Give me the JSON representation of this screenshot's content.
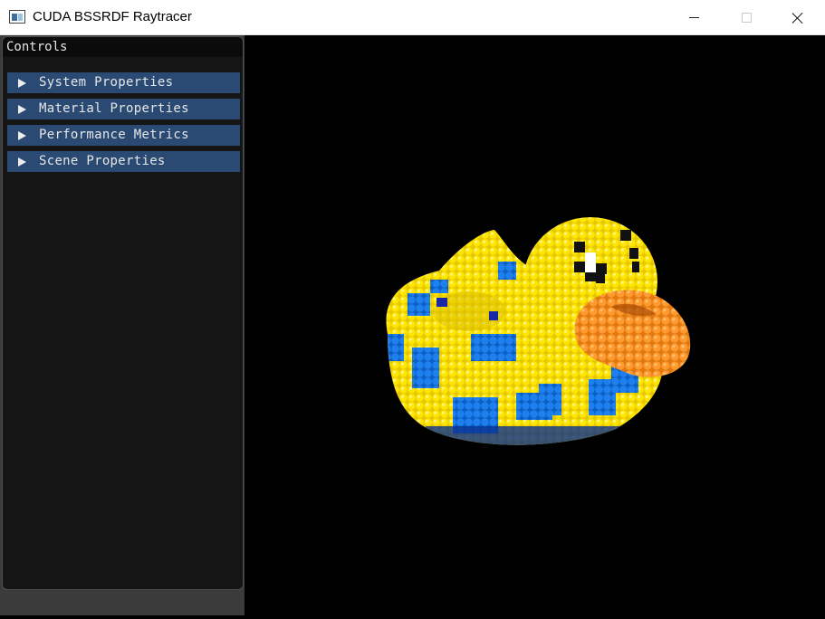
{
  "window": {
    "title": "CUDA BSSRDF Raytracer",
    "icon": "app-window-icon"
  },
  "controls": {
    "header": "Controls",
    "sections": [
      {
        "label": "System Properties",
        "state": "collapsed"
      },
      {
        "label": "Material Properties",
        "state": "collapsed"
      },
      {
        "label": "Performance Metrics",
        "state": "collapsed"
      },
      {
        "label": "Scene Properties",
        "state": "collapsed"
      }
    ]
  },
  "colors": {
    "section_bg": "#2a4a73",
    "panel_bg": "#151515",
    "duck_yellow": "#ffe600",
    "spot_blue": "#1e78e6",
    "beak_orange": "#ff9a30"
  }
}
